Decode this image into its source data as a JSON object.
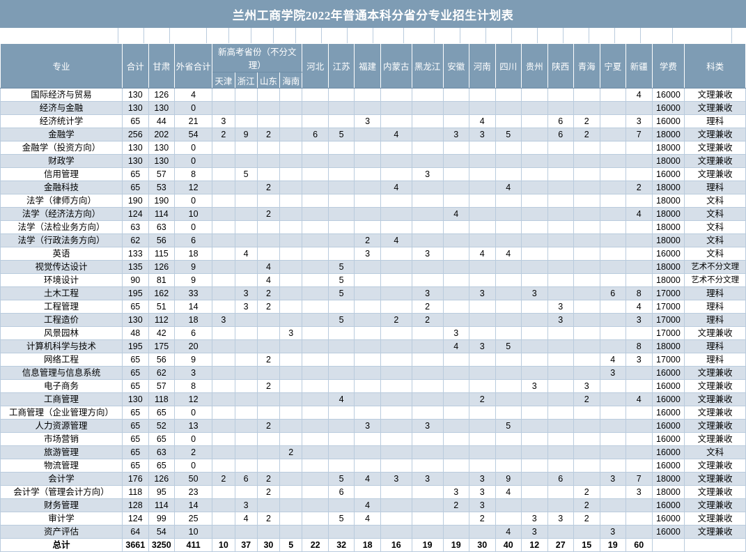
{
  "document": {
    "title": "兰州工商学院2022年普通本科分省分专业招生计划表"
  },
  "table": {
    "headers": {
      "major": "专业",
      "total": "合计",
      "gansu": "甘肃",
      "out_total": "外省合计",
      "new_gaokao_group": "新高考省份（不分文理）",
      "new_gaokao": [
        "天津",
        "浙江",
        "山东",
        "海南"
      ],
      "provinces": [
        "河北",
        "江苏",
        "福建",
        "内蒙古",
        "黑龙江",
        "安徽",
        "河南",
        "四川",
        "贵州",
        "陕西",
        "青海",
        "宁夏",
        "新疆"
      ],
      "fee": "学费",
      "category": "科类"
    },
    "rows": [
      {
        "major": "国际经济与贸易",
        "total": "130",
        "gansu": "126",
        "out": "4",
        "tj": "",
        "zj": "",
        "sd": "",
        "hn": "",
        "heb": "",
        "js": "",
        "fj": "",
        "nmg": "",
        "hlj": "",
        "ah": "",
        "hen": "",
        "sc": "",
        "gz": "",
        "sx": "",
        "qh": "",
        "nx": "",
        "xj": "4",
        "fee": "16000",
        "category": "文理兼收"
      },
      {
        "major": "经济与金融",
        "total": "130",
        "gansu": "130",
        "out": "0",
        "tj": "",
        "zj": "",
        "sd": "",
        "hn": "",
        "heb": "",
        "js": "",
        "fj": "",
        "nmg": "",
        "hlj": "",
        "ah": "",
        "hen": "",
        "sc": "",
        "gz": "",
        "sx": "",
        "qh": "",
        "nx": "",
        "xj": "",
        "fee": "16000",
        "category": "文理兼收"
      },
      {
        "major": "经济统计学",
        "total": "65",
        "gansu": "44",
        "out": "21",
        "tj": "3",
        "zj": "",
        "sd": "",
        "hn": "",
        "heb": "",
        "js": "",
        "fj": "3",
        "nmg": "",
        "hlj": "",
        "ah": "",
        "hen": "4",
        "sc": "",
        "gz": "",
        "sx": "6",
        "qh": "2",
        "nx": "",
        "xj": "3",
        "fee": "16000",
        "category": "理科"
      },
      {
        "major": "金融学",
        "total": "256",
        "gansu": "202",
        "out": "54",
        "tj": "2",
        "zj": "9",
        "sd": "2",
        "hn": "",
        "heb": "6",
        "js": "5",
        "fj": "",
        "nmg": "4",
        "hlj": "",
        "ah": "3",
        "hen": "3",
        "sc": "5",
        "gz": "",
        "sx": "6",
        "qh": "2",
        "nx": "",
        "xj": "7",
        "fee": "18000",
        "category": "文理兼收"
      },
      {
        "major": "金融学（投资方向）",
        "total": "130",
        "gansu": "130",
        "out": "0",
        "tj": "",
        "zj": "",
        "sd": "",
        "hn": "",
        "heb": "",
        "js": "",
        "fj": "",
        "nmg": "",
        "hlj": "",
        "ah": "",
        "hen": "",
        "sc": "",
        "gz": "",
        "sx": "",
        "qh": "",
        "nx": "",
        "xj": "",
        "fee": "18000",
        "category": "文理兼收"
      },
      {
        "major": "财政学",
        "total": "130",
        "gansu": "130",
        "out": "0",
        "tj": "",
        "zj": "",
        "sd": "",
        "hn": "",
        "heb": "",
        "js": "",
        "fj": "",
        "nmg": "",
        "hlj": "",
        "ah": "",
        "hen": "",
        "sc": "",
        "gz": "",
        "sx": "",
        "qh": "",
        "nx": "",
        "xj": "",
        "fee": "18000",
        "category": "文理兼收"
      },
      {
        "major": "信用管理",
        "total": "65",
        "gansu": "57",
        "out": "8",
        "tj": "",
        "zj": "5",
        "sd": "",
        "hn": "",
        "heb": "",
        "js": "",
        "fj": "",
        "nmg": "",
        "hlj": "3",
        "ah": "",
        "hen": "",
        "sc": "",
        "gz": "",
        "sx": "",
        "qh": "",
        "nx": "",
        "xj": "",
        "fee": "16000",
        "category": "文理兼收"
      },
      {
        "major": "金融科技",
        "total": "65",
        "gansu": "53",
        "out": "12",
        "tj": "",
        "zj": "",
        "sd": "2",
        "hn": "",
        "heb": "",
        "js": "",
        "fj": "",
        "nmg": "4",
        "hlj": "",
        "ah": "",
        "hen": "",
        "sc": "4",
        "gz": "",
        "sx": "",
        "qh": "",
        "nx": "",
        "xj": "2",
        "fee": "18000",
        "category": "理科"
      },
      {
        "major": "法学（律师方向）",
        "total": "190",
        "gansu": "190",
        "out": "0",
        "tj": "",
        "zj": "",
        "sd": "",
        "hn": "",
        "heb": "",
        "js": "",
        "fj": "",
        "nmg": "",
        "hlj": "",
        "ah": "",
        "hen": "",
        "sc": "",
        "gz": "",
        "sx": "",
        "qh": "",
        "nx": "",
        "xj": "",
        "fee": "18000",
        "category": "文科"
      },
      {
        "major": "法学（经济法方向）",
        "total": "124",
        "gansu": "114",
        "out": "10",
        "tj": "",
        "zj": "",
        "sd": "2",
        "hn": "",
        "heb": "",
        "js": "",
        "fj": "",
        "nmg": "",
        "hlj": "",
        "ah": "4",
        "hen": "",
        "sc": "",
        "gz": "",
        "sx": "",
        "qh": "",
        "nx": "",
        "xj": "4",
        "fee": "18000",
        "category": "文科"
      },
      {
        "major": "法学（法检业务方向）",
        "total": "63",
        "gansu": "63",
        "out": "0",
        "tj": "",
        "zj": "",
        "sd": "",
        "hn": "",
        "heb": "",
        "js": "",
        "fj": "",
        "nmg": "",
        "hlj": "",
        "ah": "",
        "hen": "",
        "sc": "",
        "gz": "",
        "sx": "",
        "qh": "",
        "nx": "",
        "xj": "",
        "fee": "18000",
        "category": "文科"
      },
      {
        "major": "法学（行政法务方向）",
        "total": "62",
        "gansu": "56",
        "out": "6",
        "tj": "",
        "zj": "",
        "sd": "",
        "hn": "",
        "heb": "",
        "js": "",
        "fj": "2",
        "nmg": "4",
        "hlj": "",
        "ah": "",
        "hen": "",
        "sc": "",
        "gz": "",
        "sx": "",
        "qh": "",
        "nx": "",
        "xj": "",
        "fee": "18000",
        "category": "文科"
      },
      {
        "major": "英语",
        "total": "133",
        "gansu": "115",
        "out": "18",
        "tj": "",
        "zj": "4",
        "sd": "",
        "hn": "",
        "heb": "",
        "js": "",
        "fj": "3",
        "nmg": "",
        "hlj": "3",
        "ah": "",
        "hen": "4",
        "sc": "4",
        "gz": "",
        "sx": "",
        "qh": "",
        "nx": "",
        "xj": "",
        "fee": "16000",
        "category": "文科"
      },
      {
        "major": "视觉传达设计",
        "total": "135",
        "gansu": "126",
        "out": "9",
        "tj": "",
        "zj": "",
        "sd": "4",
        "hn": "",
        "heb": "",
        "js": "5",
        "fj": "",
        "nmg": "",
        "hlj": "",
        "ah": "",
        "hen": "",
        "sc": "",
        "gz": "",
        "sx": "",
        "qh": "",
        "nx": "",
        "xj": "",
        "fee": "18000",
        "category": "艺术不分文理"
      },
      {
        "major": "环境设计",
        "total": "90",
        "gansu": "81",
        "out": "9",
        "tj": "",
        "zj": "",
        "sd": "4",
        "hn": "",
        "heb": "",
        "js": "5",
        "fj": "",
        "nmg": "",
        "hlj": "",
        "ah": "",
        "hen": "",
        "sc": "",
        "gz": "",
        "sx": "",
        "qh": "",
        "nx": "",
        "xj": "",
        "fee": "18000",
        "category": "艺术不分文理"
      },
      {
        "major": "土木工程",
        "total": "195",
        "gansu": "162",
        "out": "33",
        "tj": "",
        "zj": "3",
        "sd": "2",
        "hn": "",
        "heb": "",
        "js": "5",
        "fj": "",
        "nmg": "",
        "hlj": "3",
        "ah": "",
        "hen": "3",
        "sc": "",
        "gz": "3",
        "sx": "",
        "qh": "",
        "nx": "6",
        "xj": "8",
        "fee": "17000",
        "category": "理科"
      },
      {
        "major": "工程管理",
        "total": "65",
        "gansu": "51",
        "out": "14",
        "tj": "",
        "zj": "3",
        "sd": "2",
        "hn": "",
        "heb": "",
        "js": "",
        "fj": "",
        "nmg": "",
        "hlj": "2",
        "ah": "",
        "hen": "",
        "sc": "",
        "gz": "",
        "sx": "3",
        "qh": "",
        "nx": "",
        "xj": "4",
        "fee": "17000",
        "category": "理科"
      },
      {
        "major": "工程造价",
        "total": "130",
        "gansu": "112",
        "out": "18",
        "tj": "3",
        "zj": "",
        "sd": "",
        "hn": "",
        "heb": "",
        "js": "5",
        "fj": "",
        "nmg": "2",
        "hlj": "2",
        "ah": "",
        "hen": "",
        "sc": "",
        "gz": "",
        "sx": "3",
        "qh": "",
        "nx": "",
        "xj": "3",
        "fee": "17000",
        "category": "理科"
      },
      {
        "major": "风景园林",
        "total": "48",
        "gansu": "42",
        "out": "6",
        "tj": "",
        "zj": "",
        "sd": "",
        "hn": "3",
        "heb": "",
        "js": "",
        "fj": "",
        "nmg": "",
        "hlj": "",
        "ah": "3",
        "hen": "",
        "sc": "",
        "gz": "",
        "sx": "",
        "qh": "",
        "nx": "",
        "xj": "",
        "fee": "17000",
        "category": "文理兼收"
      },
      {
        "major": "计算机科学与技术",
        "total": "195",
        "gansu": "175",
        "out": "20",
        "tj": "",
        "zj": "",
        "sd": "",
        "hn": "",
        "heb": "",
        "js": "",
        "fj": "",
        "nmg": "",
        "hlj": "",
        "ah": "4",
        "hen": "3",
        "sc": "5",
        "gz": "",
        "sx": "",
        "qh": "",
        "nx": "",
        "xj": "8",
        "fee": "18000",
        "category": "理科"
      },
      {
        "major": "网络工程",
        "total": "65",
        "gansu": "56",
        "out": "9",
        "tj": "",
        "zj": "",
        "sd": "2",
        "hn": "",
        "heb": "",
        "js": "",
        "fj": "",
        "nmg": "",
        "hlj": "",
        "ah": "",
        "hen": "",
        "sc": "",
        "gz": "",
        "sx": "",
        "qh": "",
        "nx": "4",
        "xj": "3",
        "fee": "17000",
        "category": "理科"
      },
      {
        "major": "信息管理与信息系统",
        "total": "65",
        "gansu": "62",
        "out": "3",
        "tj": "",
        "zj": "",
        "sd": "",
        "hn": "",
        "heb": "",
        "js": "",
        "fj": "",
        "nmg": "",
        "hlj": "",
        "ah": "",
        "hen": "",
        "sc": "",
        "gz": "",
        "sx": "",
        "qh": "",
        "nx": "3",
        "xj": "",
        "fee": "16000",
        "category": "文理兼收"
      },
      {
        "major": "电子商务",
        "total": "65",
        "gansu": "57",
        "out": "8",
        "tj": "",
        "zj": "",
        "sd": "2",
        "hn": "",
        "heb": "",
        "js": "",
        "fj": "",
        "nmg": "",
        "hlj": "",
        "ah": "",
        "hen": "",
        "sc": "",
        "gz": "3",
        "sx": "",
        "qh": "3",
        "nx": "",
        "xj": "",
        "fee": "16000",
        "category": "文理兼收"
      },
      {
        "major": "工商管理",
        "total": "130",
        "gansu": "118",
        "out": "12",
        "tj": "",
        "zj": "",
        "sd": "",
        "hn": "",
        "heb": "",
        "js": "4",
        "fj": "",
        "nmg": "",
        "hlj": "",
        "ah": "",
        "hen": "2",
        "sc": "",
        "gz": "",
        "sx": "",
        "qh": "2",
        "nx": "",
        "xj": "4",
        "fee": "16000",
        "category": "文理兼收"
      },
      {
        "major": "工商管理（企业管理方向）",
        "total": "65",
        "gansu": "65",
        "out": "0",
        "tj": "",
        "zj": "",
        "sd": "",
        "hn": "",
        "heb": "",
        "js": "",
        "fj": "",
        "nmg": "",
        "hlj": "",
        "ah": "",
        "hen": "",
        "sc": "",
        "gz": "",
        "sx": "",
        "qh": "",
        "nx": "",
        "xj": "",
        "fee": "16000",
        "category": "文理兼收"
      },
      {
        "major": "人力资源管理",
        "total": "65",
        "gansu": "52",
        "out": "13",
        "tj": "",
        "zj": "",
        "sd": "2",
        "hn": "",
        "heb": "",
        "js": "",
        "fj": "3",
        "nmg": "",
        "hlj": "3",
        "ah": "",
        "hen": "",
        "sc": "5",
        "gz": "",
        "sx": "",
        "qh": "",
        "nx": "",
        "xj": "",
        "fee": "16000",
        "category": "文理兼收"
      },
      {
        "major": "市场营销",
        "total": "65",
        "gansu": "65",
        "out": "0",
        "tj": "",
        "zj": "",
        "sd": "",
        "hn": "",
        "heb": "",
        "js": "",
        "fj": "",
        "nmg": "",
        "hlj": "",
        "ah": "",
        "hen": "",
        "sc": "",
        "gz": "",
        "sx": "",
        "qh": "",
        "nx": "",
        "xj": "",
        "fee": "16000",
        "category": "文理兼收"
      },
      {
        "major": "旅游管理",
        "total": "65",
        "gansu": "63",
        "out": "2",
        "tj": "",
        "zj": "",
        "sd": "",
        "hn": "2",
        "heb": "",
        "js": "",
        "fj": "",
        "nmg": "",
        "hlj": "",
        "ah": "",
        "hen": "",
        "sc": "",
        "gz": "",
        "sx": "",
        "qh": "",
        "nx": "",
        "xj": "",
        "fee": "16000",
        "category": "文科"
      },
      {
        "major": "物流管理",
        "total": "65",
        "gansu": "65",
        "out": "0",
        "tj": "",
        "zj": "",
        "sd": "",
        "hn": "",
        "heb": "",
        "js": "",
        "fj": "",
        "nmg": "",
        "hlj": "",
        "ah": "",
        "hen": "",
        "sc": "",
        "gz": "",
        "sx": "",
        "qh": "",
        "nx": "",
        "xj": "",
        "fee": "16000",
        "category": "文理兼收"
      },
      {
        "major": "会计学",
        "total": "176",
        "gansu": "126",
        "out": "50",
        "tj": "2",
        "zj": "6",
        "sd": "2",
        "hn": "",
        "heb": "",
        "js": "5",
        "fj": "4",
        "nmg": "3",
        "hlj": "3",
        "ah": "",
        "hen": "3",
        "sc": "9",
        "gz": "",
        "sx": "6",
        "qh": "",
        "nx": "3",
        "xj": "7",
        "fee": "18000",
        "category": "文理兼收"
      },
      {
        "major": "会计学（管理会计方向）",
        "total": "118",
        "gansu": "95",
        "out": "23",
        "tj": "",
        "zj": "",
        "sd": "2",
        "hn": "",
        "heb": "",
        "js": "6",
        "fj": "",
        "nmg": "",
        "hlj": "",
        "ah": "3",
        "hen": "3",
        "sc": "4",
        "gz": "",
        "sx": "",
        "qh": "2",
        "nx": "",
        "xj": "3",
        "fee": "18000",
        "category": "文理兼收"
      },
      {
        "major": "财务管理",
        "total": "128",
        "gansu": "114",
        "out": "14",
        "tj": "",
        "zj": "3",
        "sd": "",
        "hn": "",
        "heb": "",
        "js": "",
        "fj": "4",
        "nmg": "",
        "hlj": "",
        "ah": "2",
        "hen": "3",
        "sc": "",
        "gz": "",
        "sx": "",
        "qh": "2",
        "nx": "",
        "xj": "",
        "fee": "16000",
        "category": "文理兼收"
      },
      {
        "major": "审计学",
        "total": "124",
        "gansu": "99",
        "out": "25",
        "tj": "",
        "zj": "4",
        "sd": "2",
        "hn": "",
        "heb": "",
        "js": "5",
        "fj": "4",
        "nmg": "",
        "hlj": "",
        "ah": "",
        "hen": "2",
        "sc": "",
        "gz": "3",
        "sx": "3",
        "qh": "2",
        "nx": "",
        "xj": "",
        "fee": "16000",
        "category": "文理兼收"
      },
      {
        "major": "资产评估",
        "total": "64",
        "gansu": "54",
        "out": "10",
        "tj": "",
        "zj": "",
        "sd": "",
        "hn": "",
        "heb": "",
        "js": "",
        "fj": "",
        "nmg": "",
        "hlj": "",
        "ah": "",
        "hen": "",
        "sc": "4",
        "gz": "3",
        "sx": "",
        "qh": "",
        "nx": "3",
        "xj": "",
        "fee": "16000",
        "category": "文理兼收"
      }
    ],
    "total_row": {
      "major": "总计",
      "total": "3661",
      "gansu": "3250",
      "out": "411",
      "tj": "10",
      "zj": "37",
      "sd": "30",
      "hn": "5",
      "heb": "22",
      "js": "32",
      "fj": "18",
      "nmg": "16",
      "hlj": "19",
      "ah": "19",
      "hen": "30",
      "sc": "40",
      "gz": "12",
      "sx": "27",
      "qh": "15",
      "nx": "19",
      "xj": "60",
      "fee": "",
      "category": ""
    }
  }
}
